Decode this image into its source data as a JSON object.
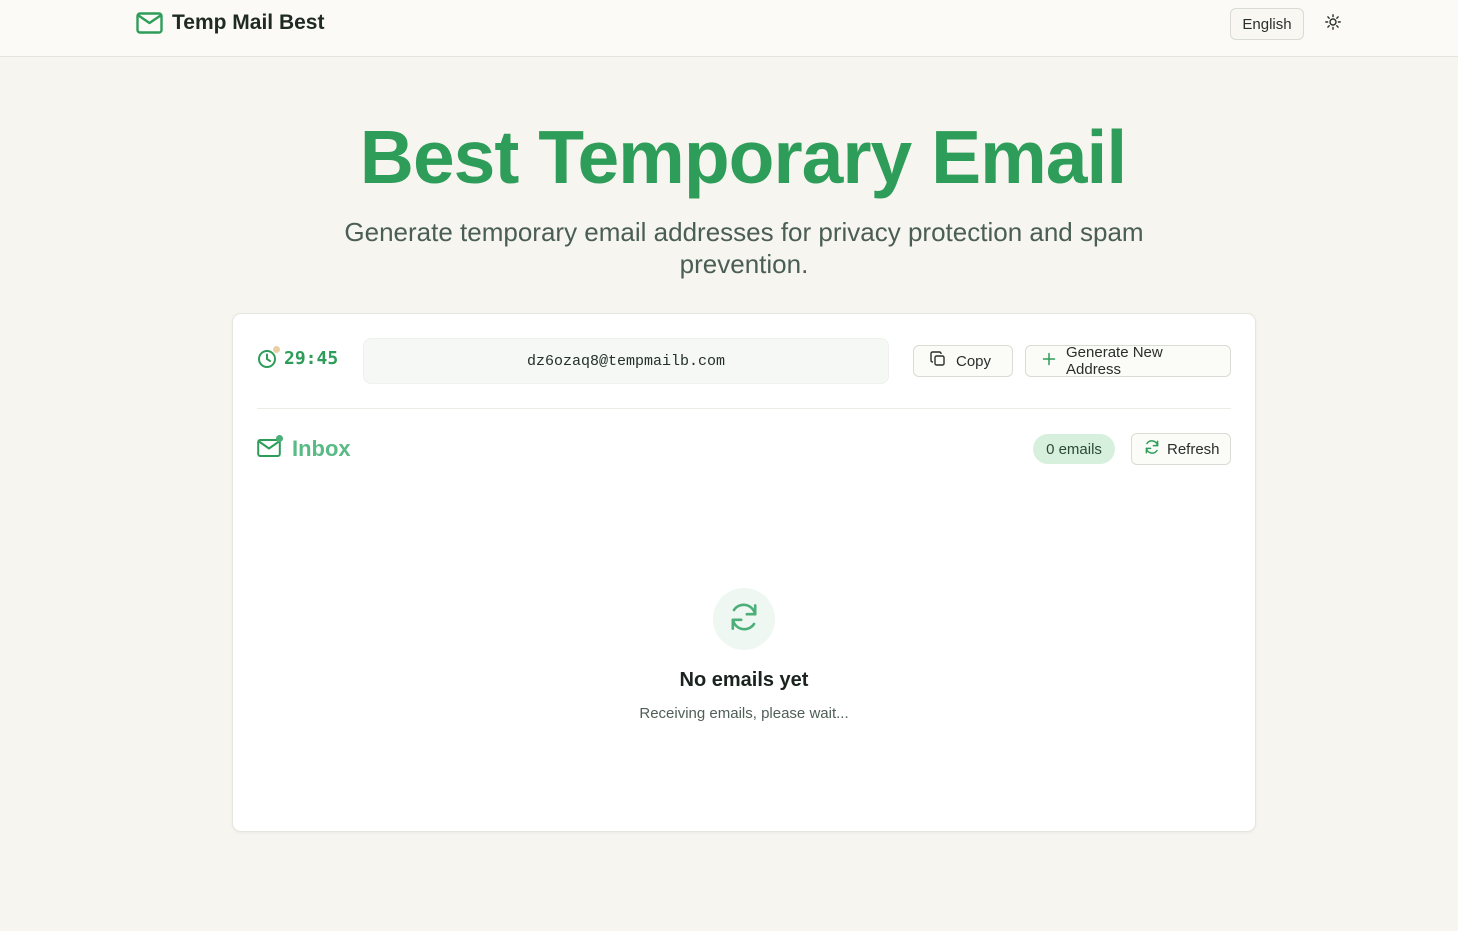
{
  "header": {
    "brand": "Temp Mail Best",
    "language": "English"
  },
  "hero": {
    "title": "Best Temporary Email",
    "subtitle": "Generate temporary email addresses for privacy protection and spam prevention."
  },
  "mailbox": {
    "timer": "29:45",
    "address": "dz6ozaq8@tempmailb.com",
    "copy_label": "Copy",
    "generate_label": "Generate New Address"
  },
  "inbox": {
    "title": "Inbox",
    "count_label": "0 emails",
    "refresh_label": "Refresh",
    "empty_title": "No emails yet",
    "empty_subtitle": "Receiving emails, please wait..."
  },
  "icons": {
    "brand": "mail-icon",
    "theme": "sun-icon",
    "timer": "clock-icon",
    "copy": "copy-icon",
    "generate": "plus-icon",
    "inbox": "mail-icon",
    "refresh": "refresh-icon",
    "empty": "refresh-icon"
  },
  "colors": {
    "accent": "#2e9d59",
    "accent_light": "#5aba86",
    "badge_bg": "#d6f0dd",
    "background": "#f7f5f0"
  }
}
